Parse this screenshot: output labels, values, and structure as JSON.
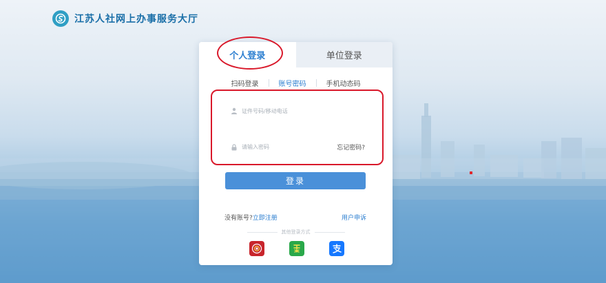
{
  "header": {
    "site_title": "江苏人社网上办事服务大厅",
    "logo_icon": "s-swirl-logo-icon"
  },
  "login_tabs": {
    "personal": "个人登录",
    "organization": "单位登录",
    "active": "personal"
  },
  "login_methods": {
    "scan": "扫码登录",
    "account_password": "账号密码",
    "phone_code": "手机动态码",
    "active": "account_password"
  },
  "form": {
    "username_placeholder": "证件号码/移动电话",
    "password_placeholder": "请输入密码",
    "forgot_password": "忘记密码?",
    "user_icon": "user-icon",
    "lock_icon": "lock-icon"
  },
  "login_button": "登录",
  "footer": {
    "no_account": "没有账号?",
    "register": "立即注册",
    "user_appeal": "用户申诉",
    "other_methods": "其他登录方式"
  },
  "third_party": [
    {
      "name": "jiangsu-hrss-app-icon",
      "color": "#c8252c"
    },
    {
      "name": "su-app-icon",
      "color": "#2aa84a"
    },
    {
      "name": "alipay-icon",
      "color": "#1678ff"
    }
  ],
  "colors": {
    "accent": "#4a90d9",
    "active_text": "#2d7fd0",
    "annotation": "#d9182a"
  }
}
